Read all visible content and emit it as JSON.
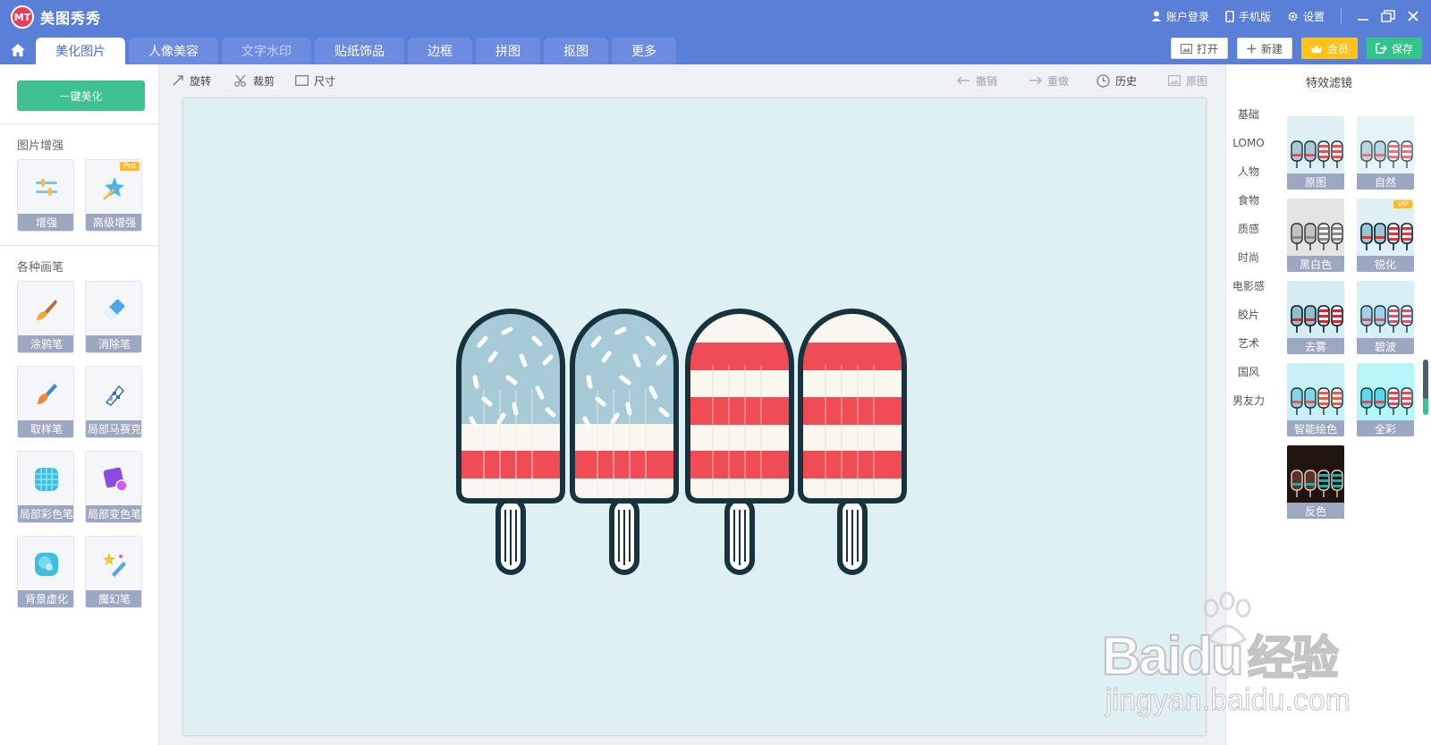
{
  "app": {
    "logo_text": "美图秀秀",
    "logo_badge": "MT"
  },
  "top_right": {
    "login": "账户登录",
    "mobile": "手机版",
    "settings": "设置"
  },
  "tabs": [
    "美化图片",
    "人像美容",
    "文字水印",
    "贴纸饰品",
    "边框",
    "拼图",
    "抠图",
    "更多"
  ],
  "actions": {
    "open": "打开",
    "new": "新建",
    "member": "会员",
    "save": "保存"
  },
  "left": {
    "one_click": "一键美化",
    "section_enhance": "图片增强",
    "section_brush": "各种画笔",
    "pro_badge": "Pro",
    "tools": [
      {
        "label": "增强",
        "icon": "sliders-icon"
      },
      {
        "label": "高级增强",
        "icon": "magic-wand-icon"
      },
      {
        "label": "涂鸦笔",
        "icon": "paint-brush-icon"
      },
      {
        "label": "消除笔",
        "icon": "eraser-icon"
      },
      {
        "label": "取样笔",
        "icon": "sampling-brush-icon"
      },
      {
        "label": "局部马赛克",
        "icon": "mosaic-pen-icon"
      },
      {
        "label": "局部彩色笔",
        "icon": "color-pen-icon"
      },
      {
        "label": "局部变色笔",
        "icon": "recolor-pen-icon"
      },
      {
        "label": "背景虚化",
        "icon": "blur-background-icon"
      },
      {
        "label": "魔幻笔",
        "icon": "magic-pen-icon"
      }
    ]
  },
  "toolbar": {
    "rotate": "旋转",
    "crop": "裁剪",
    "size": "尺寸",
    "undo": "撤销",
    "redo": "重做",
    "history": "历史",
    "original": "原图"
  },
  "right": {
    "title": "特效滤镜",
    "categories": [
      "基础",
      "LOMO",
      "人物",
      "食物",
      "质感",
      "时尚",
      "电影感",
      "胶片",
      "艺术",
      "国风",
      "男友力"
    ],
    "vip_badge": "VIP",
    "filters": [
      "原图",
      "自然",
      "黑白色",
      "锐化",
      "去雾",
      "碧波",
      "智能绘色",
      "全彩",
      "反色"
    ]
  },
  "watermark": {
    "brand": "Bai",
    "brand_mid": "du",
    "brand_cn": "经验",
    "url": "jingyan.baidu.com"
  },
  "colors": {
    "topbar": "#5a7fd6",
    "accent_green": "#3fc290",
    "popsicle_red": "#ef4c55",
    "popsicle_cream": "#faf7ef",
    "popsicle_blue": "#a7cbd6",
    "outline": "#17333d",
    "canvas_bg": "#dff0f4"
  }
}
